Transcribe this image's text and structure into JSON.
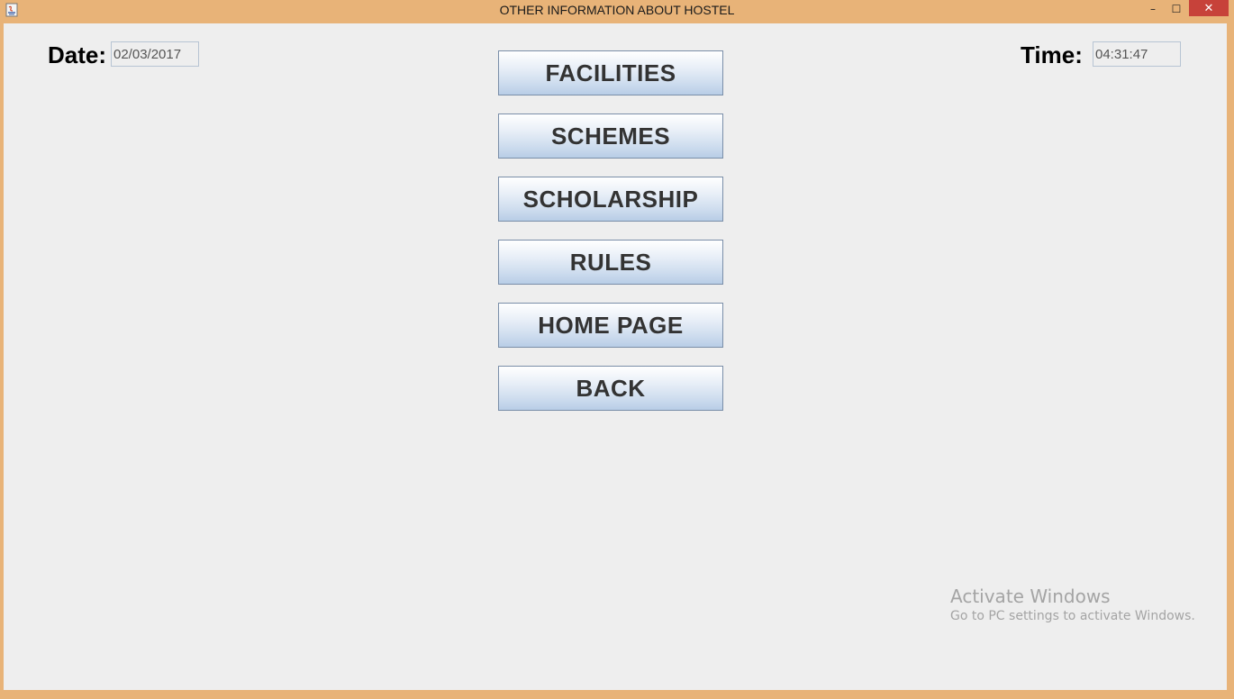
{
  "window": {
    "title": "OTHER INFORMATION ABOUT HOSTEL",
    "controls": {
      "minimize": "–",
      "maximize": "☐",
      "close": "✕"
    }
  },
  "date": {
    "label": "Date:",
    "value": "02/03/2017"
  },
  "time": {
    "label": "Time:",
    "value": "04:31:47"
  },
  "menu": {
    "facilities": "FACILITIES",
    "schemes": "SCHEMES",
    "scholarship": "SCHOLARSHIP",
    "rules": "RULES",
    "home_page": "HOME PAGE",
    "back": "BACK"
  },
  "watermark": {
    "title": "Activate Windows",
    "subtitle": "Go to PC settings to activate Windows."
  },
  "colors": {
    "titlebar": "#e8b378",
    "client_bg": "#eeeeee",
    "close_button": "#c7423a"
  }
}
